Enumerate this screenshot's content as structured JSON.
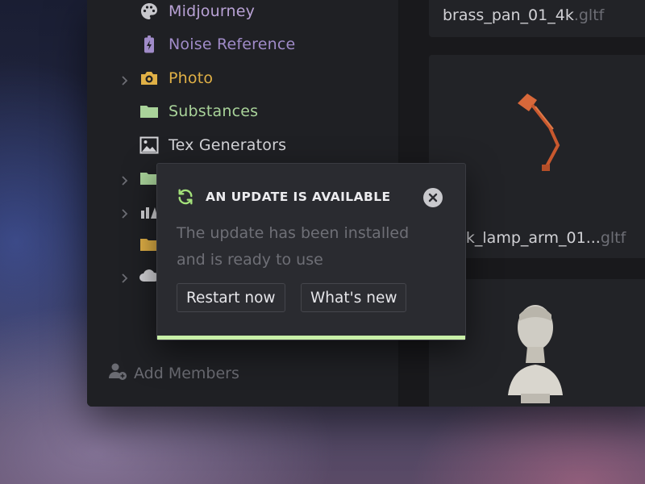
{
  "sidebar": {
    "items": [
      {
        "label": "Midjourney",
        "icon": "palette-icon",
        "color": "#b9a2d6",
        "chevron": false
      },
      {
        "label": "Noise Reference",
        "icon": "battery-charging-icon",
        "color": "#a08bc8",
        "chevron": false
      },
      {
        "label": "Photo",
        "icon": "camera-icon",
        "color": "#e0b046",
        "chevron": true
      },
      {
        "label": "Substances",
        "icon": "folder-icon",
        "color": "#a9d39a",
        "chevron": false
      },
      {
        "label": "Tex Generators",
        "icon": "image-icon",
        "color": "#d4d4d8",
        "chevron": false
      }
    ],
    "add_members": "Add Members"
  },
  "cards": [
    {
      "name": "brass_pan_01_4k",
      "ext": ".gltf"
    },
    {
      "name": "sk_lamp_arm_01...",
      "ext": "gltf"
    }
  ],
  "toast": {
    "title": "AN UPDATE IS AVAILABLE",
    "message": "The update has been installed and is ready to use",
    "restart_label": "Restart now",
    "whats_new_label": "What's new",
    "progress": 1.0,
    "accent": "#c9f0a8"
  }
}
